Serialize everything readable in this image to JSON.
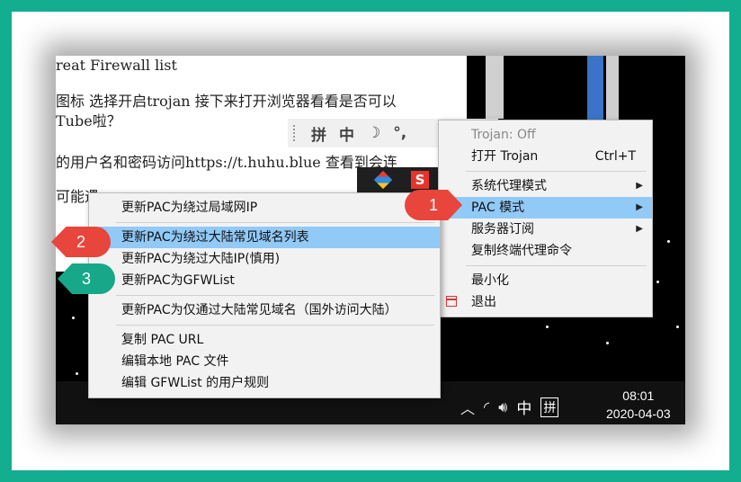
{
  "document": {
    "lines": [
      "reat Firewall list",
      "图标 选择开启trojan 接下来打开浏览器看看是否可以",
      "Tube啦？",
      "的用户名和密码访问https://t.huhu.blue 查看到会连",
      "可能遇"
    ]
  },
  "ime_bar": {
    "items": [
      "拼",
      "中",
      "☽",
      "°,"
    ]
  },
  "tray_menu": {
    "status": "Trojan: Off",
    "open": "打开 Trojan",
    "open_shortcut": "Ctrl+T",
    "proxy_mode": "系统代理模式",
    "pac_mode": "PAC 模式",
    "subscription": "服务器订阅",
    "copy_cmd": "复制终端代理命令",
    "minimize": "最小化",
    "exit": "退出"
  },
  "pac_submenu": {
    "items": [
      "更新PAC为绕过局域网IP",
      "更新PAC为绕过大陆常见域名列表",
      "更新PAC为绕过大陆IP(慎用)",
      "更新PAC为GFWList",
      "更新PAC为仅通过大陆常见域名（国外访问大陆）",
      "复制 PAC URL",
      "编辑本地 PAC 文件",
      "编辑 GFWList 的用户规则"
    ]
  },
  "badges": [
    "1",
    "2",
    "3"
  ],
  "taskbar": {
    "ime_mode": "中",
    "ime_pinyin": "拼",
    "time": "08:01",
    "date": "2020-04-03"
  },
  "colors": {
    "border": "#13ae8f",
    "highlight": "#91c9f7",
    "badge_red": "#e8453c",
    "badge_green": "#17a889"
  }
}
